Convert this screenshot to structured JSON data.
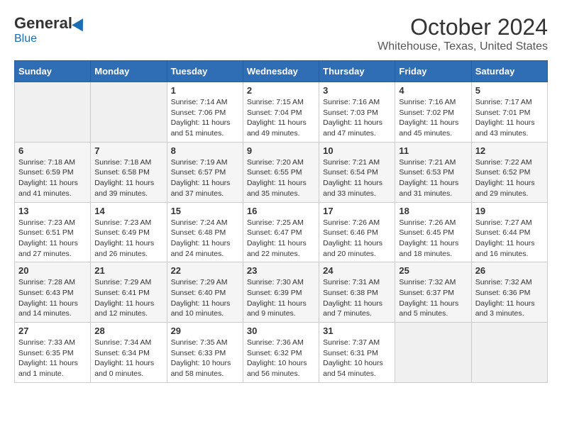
{
  "logo": {
    "general": "General",
    "blue": "Blue"
  },
  "header": {
    "title": "October 2024",
    "subtitle": "Whitehouse, Texas, United States"
  },
  "weekdays": [
    "Sunday",
    "Monday",
    "Tuesday",
    "Wednesday",
    "Thursday",
    "Friday",
    "Saturday"
  ],
  "weeks": [
    [
      {
        "day": "",
        "sunrise": "",
        "sunset": "",
        "daylight": ""
      },
      {
        "day": "",
        "sunrise": "",
        "sunset": "",
        "daylight": ""
      },
      {
        "day": "1",
        "sunrise": "Sunrise: 7:14 AM",
        "sunset": "Sunset: 7:06 PM",
        "daylight": "Daylight: 11 hours and 51 minutes."
      },
      {
        "day": "2",
        "sunrise": "Sunrise: 7:15 AM",
        "sunset": "Sunset: 7:04 PM",
        "daylight": "Daylight: 11 hours and 49 minutes."
      },
      {
        "day": "3",
        "sunrise": "Sunrise: 7:16 AM",
        "sunset": "Sunset: 7:03 PM",
        "daylight": "Daylight: 11 hours and 47 minutes."
      },
      {
        "day": "4",
        "sunrise": "Sunrise: 7:16 AM",
        "sunset": "Sunset: 7:02 PM",
        "daylight": "Daylight: 11 hours and 45 minutes."
      },
      {
        "day": "5",
        "sunrise": "Sunrise: 7:17 AM",
        "sunset": "Sunset: 7:01 PM",
        "daylight": "Daylight: 11 hours and 43 minutes."
      }
    ],
    [
      {
        "day": "6",
        "sunrise": "Sunrise: 7:18 AM",
        "sunset": "Sunset: 6:59 PM",
        "daylight": "Daylight: 11 hours and 41 minutes."
      },
      {
        "day": "7",
        "sunrise": "Sunrise: 7:18 AM",
        "sunset": "Sunset: 6:58 PM",
        "daylight": "Daylight: 11 hours and 39 minutes."
      },
      {
        "day": "8",
        "sunrise": "Sunrise: 7:19 AM",
        "sunset": "Sunset: 6:57 PM",
        "daylight": "Daylight: 11 hours and 37 minutes."
      },
      {
        "day": "9",
        "sunrise": "Sunrise: 7:20 AM",
        "sunset": "Sunset: 6:55 PM",
        "daylight": "Daylight: 11 hours and 35 minutes."
      },
      {
        "day": "10",
        "sunrise": "Sunrise: 7:21 AM",
        "sunset": "Sunset: 6:54 PM",
        "daylight": "Daylight: 11 hours and 33 minutes."
      },
      {
        "day": "11",
        "sunrise": "Sunrise: 7:21 AM",
        "sunset": "Sunset: 6:53 PM",
        "daylight": "Daylight: 11 hours and 31 minutes."
      },
      {
        "day": "12",
        "sunrise": "Sunrise: 7:22 AM",
        "sunset": "Sunset: 6:52 PM",
        "daylight": "Daylight: 11 hours and 29 minutes."
      }
    ],
    [
      {
        "day": "13",
        "sunrise": "Sunrise: 7:23 AM",
        "sunset": "Sunset: 6:51 PM",
        "daylight": "Daylight: 11 hours and 27 minutes."
      },
      {
        "day": "14",
        "sunrise": "Sunrise: 7:23 AM",
        "sunset": "Sunset: 6:49 PM",
        "daylight": "Daylight: 11 hours and 26 minutes."
      },
      {
        "day": "15",
        "sunrise": "Sunrise: 7:24 AM",
        "sunset": "Sunset: 6:48 PM",
        "daylight": "Daylight: 11 hours and 24 minutes."
      },
      {
        "day": "16",
        "sunrise": "Sunrise: 7:25 AM",
        "sunset": "Sunset: 6:47 PM",
        "daylight": "Daylight: 11 hours and 22 minutes."
      },
      {
        "day": "17",
        "sunrise": "Sunrise: 7:26 AM",
        "sunset": "Sunset: 6:46 PM",
        "daylight": "Daylight: 11 hours and 20 minutes."
      },
      {
        "day": "18",
        "sunrise": "Sunrise: 7:26 AM",
        "sunset": "Sunset: 6:45 PM",
        "daylight": "Daylight: 11 hours and 18 minutes."
      },
      {
        "day": "19",
        "sunrise": "Sunrise: 7:27 AM",
        "sunset": "Sunset: 6:44 PM",
        "daylight": "Daylight: 11 hours and 16 minutes."
      }
    ],
    [
      {
        "day": "20",
        "sunrise": "Sunrise: 7:28 AM",
        "sunset": "Sunset: 6:43 PM",
        "daylight": "Daylight: 11 hours and 14 minutes."
      },
      {
        "day": "21",
        "sunrise": "Sunrise: 7:29 AM",
        "sunset": "Sunset: 6:41 PM",
        "daylight": "Daylight: 11 hours and 12 minutes."
      },
      {
        "day": "22",
        "sunrise": "Sunrise: 7:29 AM",
        "sunset": "Sunset: 6:40 PM",
        "daylight": "Daylight: 11 hours and 10 minutes."
      },
      {
        "day": "23",
        "sunrise": "Sunrise: 7:30 AM",
        "sunset": "Sunset: 6:39 PM",
        "daylight": "Daylight: 11 hours and 9 minutes."
      },
      {
        "day": "24",
        "sunrise": "Sunrise: 7:31 AM",
        "sunset": "Sunset: 6:38 PM",
        "daylight": "Daylight: 11 hours and 7 minutes."
      },
      {
        "day": "25",
        "sunrise": "Sunrise: 7:32 AM",
        "sunset": "Sunset: 6:37 PM",
        "daylight": "Daylight: 11 hours and 5 minutes."
      },
      {
        "day": "26",
        "sunrise": "Sunrise: 7:32 AM",
        "sunset": "Sunset: 6:36 PM",
        "daylight": "Daylight: 11 hours and 3 minutes."
      }
    ],
    [
      {
        "day": "27",
        "sunrise": "Sunrise: 7:33 AM",
        "sunset": "Sunset: 6:35 PM",
        "daylight": "Daylight: 11 hours and 1 minute."
      },
      {
        "day": "28",
        "sunrise": "Sunrise: 7:34 AM",
        "sunset": "Sunset: 6:34 PM",
        "daylight": "Daylight: 11 hours and 0 minutes."
      },
      {
        "day": "29",
        "sunrise": "Sunrise: 7:35 AM",
        "sunset": "Sunset: 6:33 PM",
        "daylight": "Daylight: 10 hours and 58 minutes."
      },
      {
        "day": "30",
        "sunrise": "Sunrise: 7:36 AM",
        "sunset": "Sunset: 6:32 PM",
        "daylight": "Daylight: 10 hours and 56 minutes."
      },
      {
        "day": "31",
        "sunrise": "Sunrise: 7:37 AM",
        "sunset": "Sunset: 6:31 PM",
        "daylight": "Daylight: 10 hours and 54 minutes."
      },
      {
        "day": "",
        "sunrise": "",
        "sunset": "",
        "daylight": ""
      },
      {
        "day": "",
        "sunrise": "",
        "sunset": "",
        "daylight": ""
      }
    ]
  ]
}
